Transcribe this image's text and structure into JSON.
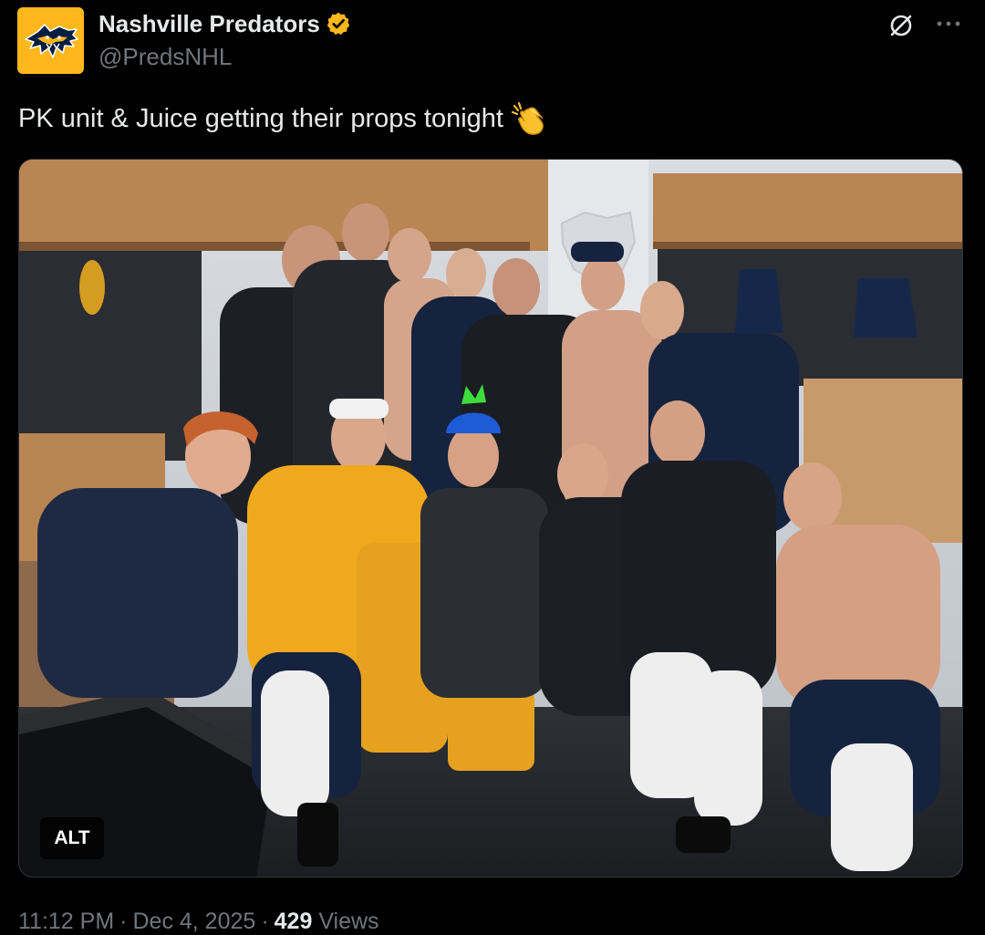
{
  "author": {
    "display_name": "Nashville Predators",
    "handle": "@PredsNHL",
    "verified_badge_color": "#ffb81c",
    "avatar_bg": "#ffb81c",
    "avatar_icon": "predators-logo-icon"
  },
  "header_actions": {
    "grok_icon": "grok-icon",
    "more_icon": "more-icon"
  },
  "post": {
    "text": "PK unit & Juice getting their props tonight",
    "emoji": "clapping-hands-emoji"
  },
  "media": {
    "alt_label": "ALT"
  },
  "meta": {
    "time": "11:12 PM",
    "separator": "·",
    "date": "Dec 4, 2025",
    "views_count": "429",
    "views_label": "Views"
  },
  "colors": {
    "background": "#000000",
    "text_primary": "#e7e9ea",
    "text_secondary": "#71767b",
    "brand_gold": "#ffb81c",
    "brand_navy": "#041e42"
  }
}
